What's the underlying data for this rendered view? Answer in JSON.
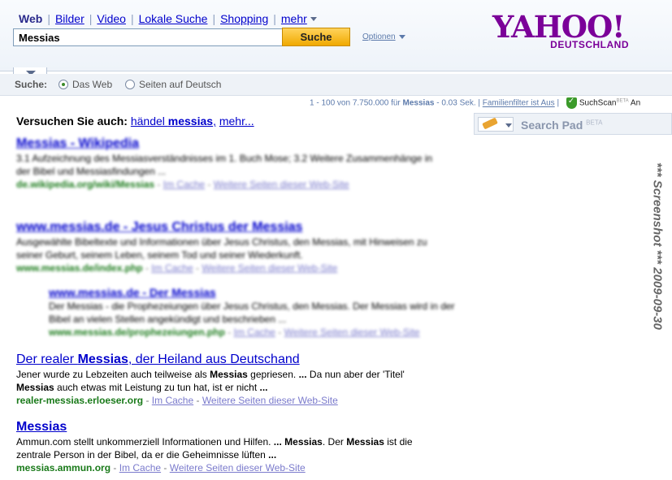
{
  "header": {
    "tabs": [
      {
        "label": "Web",
        "active": true
      },
      {
        "label": "Bilder"
      },
      {
        "label": "Video"
      },
      {
        "label": "Lokale Suche"
      },
      {
        "label": "Shopping"
      },
      {
        "label": "mehr"
      }
    ],
    "search": {
      "value": "Messias"
    },
    "search_button": "Suche",
    "options_label": "Optionen",
    "logo": {
      "main": "YAHOO!",
      "sub": "DEUTSCHLAND",
      "color": "#7b0099"
    }
  },
  "scope": {
    "label": "Suche:",
    "options": [
      {
        "label": "Das Web",
        "selected": true
      },
      {
        "label": "Seiten auf Deutsch",
        "selected": false
      }
    ]
  },
  "summary": {
    "prefix": "1 - 100 von 7.750.000 für",
    "query": "Messias",
    "time": "- 0.03 Sek. |",
    "family_filter": "Familienfilter ist Aus",
    "sep": "|",
    "suchscan": "SuchScan",
    "suchscan_beta": "BETA",
    "suchscan_state": "An"
  },
  "search_pad": {
    "label": "Search Pad",
    "beta": "BETA"
  },
  "also_try": {
    "label": "Versuchen Sie auch:",
    "links": [
      "händel messias,"
    ],
    "more": "mehr..."
  },
  "results": [
    {
      "title": "Messias - Wikipedia",
      "snippet": "3.1 Aufzeichnung des Messiasverständnisses im 1. Buch Mose; 3.2 Weitere Zusammenhänge in der Bibel und Messiasfindungen ...",
      "url": "de.wikipedia.org/wiki/Messias",
      "links": [
        "Im Cache",
        "Weitere Seiten dieser Web-Site"
      ],
      "blurred": true
    },
    {
      "title": "www.messias.de - Jesus Christus der Messias",
      "snippet": "Ausgewählte Bibeltexte und Informationen über Jesus Christus, den Messias, mit Hinweisen zu seiner Geburt, seinem Leben, seinem Tod und seiner Wiederkunft.",
      "url": "www.messias.de/index.php",
      "links": [
        "Im Cache",
        "Weitere Seiten dieser Web-Site"
      ],
      "blurred": true
    },
    {
      "title": "www.messias.de - Der Messias",
      "snippet": "Der Messias - die Prophezeiungen über Jesus Christus, den Messias. Der Messias wird in der Bibel an vielen Stellen angekündigt und beschrieben ...",
      "url": "www.messias.de/prophezeiungen.php",
      "links": [
        "Im Cache",
        "Weitere Seiten dieser Web-Site"
      ],
      "blurred": true
    },
    {
      "title_parts": [
        "Der realer ",
        "Messias",
        ", der Heiland aus Deutschand"
      ],
      "snippet_lines": [
        [
          "Jener wurde zu Lebzeiten auch teilweise als ",
          "Messias",
          " gepriesen. ",
          "...",
          " Da nun aber der 'Titel'"
        ],
        [
          "Messias",
          " auch etwas mit Leistung zu tun hat, ist er nicht ",
          "..."
        ]
      ],
      "url": "realer-messias.erloeser.org",
      "links": [
        "Im Cache",
        "Weitere Seiten dieser Web-Site"
      ],
      "blurred": false
    },
    {
      "title_parts": [
        "Messias"
      ],
      "snippet_lines": [
        [
          "Ammun.com stellt unkommerziell Informationen und Hilfen. ",
          "...",
          " ",
          "Messias",
          ". Der ",
          "Messias",
          " ist die"
        ],
        [
          "zentrale Person in der Bibel, da er die Geheimnisse lüften ",
          "..."
        ]
      ],
      "url": "messias.ammun.org",
      "links": [
        "Im Cache",
        "Weitere Seiten dieser Web-Site"
      ],
      "blurred": false
    }
  ],
  "meta_sep": " - ",
  "watermark": "*** Screenshot *** 2009-09-30"
}
